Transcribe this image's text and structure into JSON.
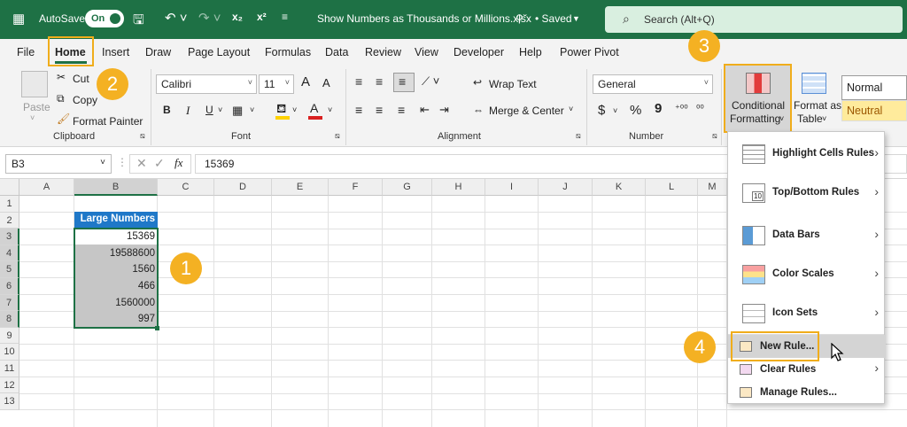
{
  "titlebar": {
    "autosave_label": "AutoSave",
    "autosave_state": "On",
    "filename": "Show Numbers as Thousands or Millions.xlsx",
    "saved_status": "• Saved",
    "search_placeholder": "Search (Alt+Q)"
  },
  "menu": {
    "tabs": [
      "File",
      "Home",
      "Insert",
      "Draw",
      "Page Layout",
      "Formulas",
      "Data",
      "Review",
      "View",
      "Developer",
      "Help",
      "Power Pivot"
    ]
  },
  "ribbon": {
    "clipboard": {
      "paste": "Paste",
      "cut": "Cut",
      "copy": "Copy",
      "format_painter": "Format Painter",
      "group": "Clipboard"
    },
    "font": {
      "name": "Calibri",
      "size": "11",
      "bold": "B",
      "italic": "I",
      "underline": "U",
      "grow": "A",
      "shrink": "A",
      "group": "Font"
    },
    "alignment": {
      "wrap_text": "Wrap Text",
      "merge_center": "Merge & Center",
      "group": "Alignment"
    },
    "number": {
      "format": "General",
      "currency": "$",
      "percent": "%",
      "comma": "9",
      "group": "Number"
    },
    "styles": {
      "conditional_formatting_line1": "Conditional",
      "conditional_formatting_line2": "Formatting",
      "format_as_table_line1": "Format as",
      "format_as_table_line2": "Table",
      "normal": "Normal",
      "neutral": "Neutral"
    }
  },
  "formula_bar": {
    "name_box": "B3",
    "fx": "fx",
    "value": "15369"
  },
  "sheet": {
    "columns": [
      "A",
      "B",
      "C",
      "D",
      "E",
      "F",
      "G",
      "H",
      "I",
      "J",
      "K",
      "L",
      "M"
    ],
    "rows": [
      "1",
      "2",
      "3",
      "4",
      "5",
      "6",
      "7",
      "8",
      "9",
      "10",
      "11",
      "12",
      "13"
    ],
    "header_cell": "Large Numbers",
    "values": [
      "15369",
      "19588600",
      "1560",
      "466",
      "1560000",
      "997"
    ]
  },
  "cf_menu": {
    "items": [
      "Highlight Cells Rules",
      "Top/Bottom Rules",
      "Data Bars",
      "Color Scales",
      "Icon Sets"
    ],
    "sub_items": [
      "New Rule...",
      "Clear Rules",
      "Manage Rules..."
    ],
    "tb_icon_text": "10"
  },
  "badges": [
    "1",
    "2",
    "3",
    "4"
  ],
  "colors": {
    "excel_green": "#1e7145",
    "highlight_orange": "#f0ad1b",
    "badge": "#f4b123",
    "selection_gray": "#c6c6c6",
    "table_header": "#1f78c8"
  }
}
